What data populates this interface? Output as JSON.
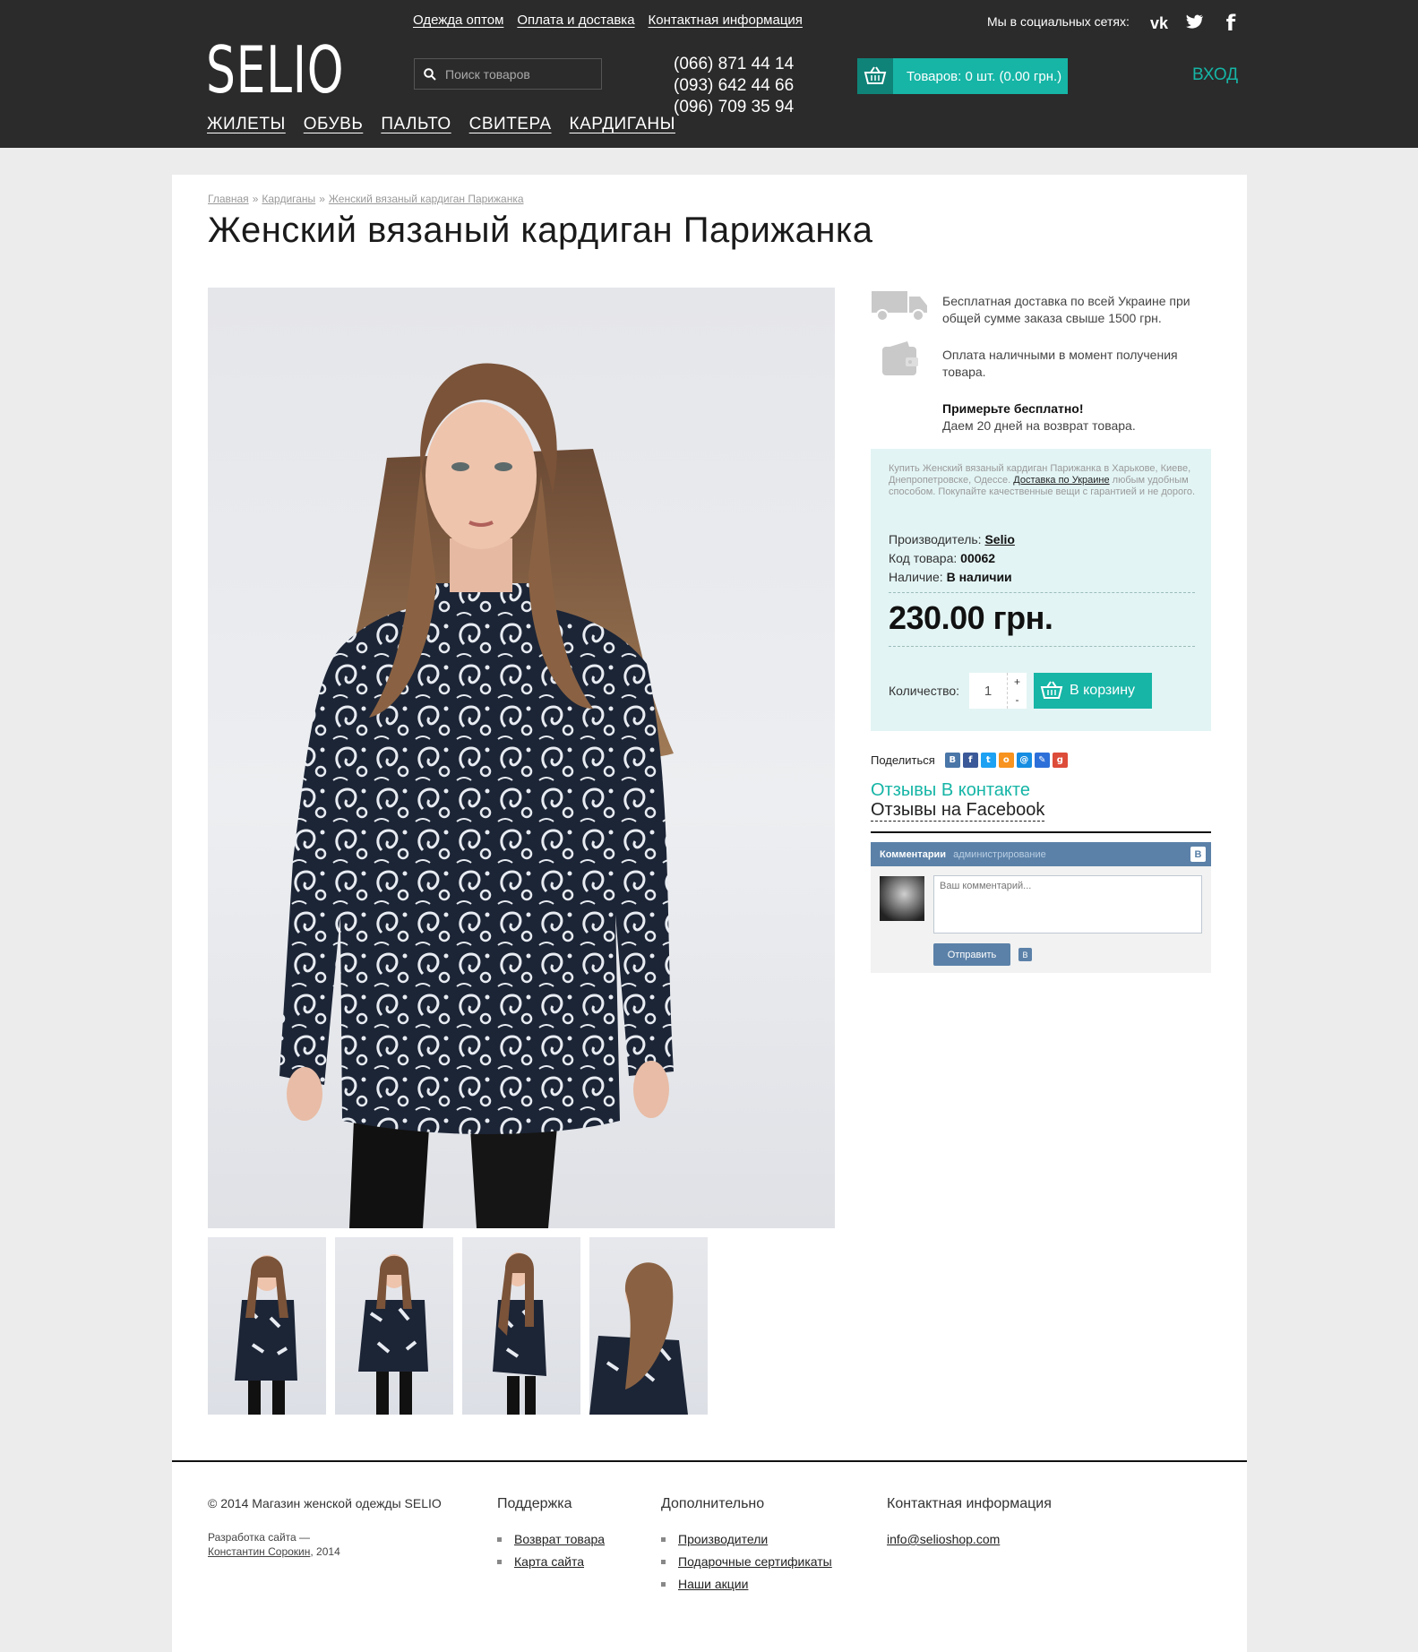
{
  "header": {
    "logo": "SELIO",
    "top_links": [
      "Одежда оптом",
      "Оплата и доставка",
      "Контактная информация"
    ],
    "search_placeholder": "Поиск товаров",
    "phones": [
      "(066) 871 44 14",
      "(093) 642 44 66",
      "(096) 709 35 94"
    ],
    "cart_label": "Товаров: 0 шт. (0.00 грн.)",
    "login": "ВХОД",
    "social_label": "Мы в социальных сетях:",
    "social_icons": [
      "vk-icon",
      "twitter-icon",
      "facebook-icon"
    ],
    "menu": [
      "ЖИЛЕТЫ",
      "ОБУВЬ",
      "ПАЛЬТО",
      "СВИТЕРА",
      "КАРДИГАНЫ"
    ]
  },
  "breadcrumb": [
    "Главная",
    "Кардиганы",
    "Женский вязаный кардиган Парижанка"
  ],
  "product": {
    "title": "Женский вязаный кардиган Парижанка",
    "benefits": [
      {
        "icon": "truck-icon",
        "text": "Бесплатная доставка по всей Украине при общей сумме заказа свыше 1500 грн."
      },
      {
        "icon": "wallet-icon",
        "text": "Оплата наличными в момент получения товара."
      }
    ],
    "try_title": "Примерьте бесплатно!",
    "try_text": "Даем 20 дней на возврат товара.",
    "desc_text": "Купить Женский вязаный кардиган Парижанка в Харькове, Киеве, Днепропетровске, Одессе.",
    "desc_link": "Доставка по Украине",
    "desc_text2": "любым удобным способом. Покупайте качественные вещи с гарантией и не дорого.",
    "manufacturer_label": "Производитель:",
    "manufacturer": "Selio",
    "sku_label": "Код товара:",
    "sku": "00062",
    "stock_label": "Наличие:",
    "stock": "В наличии",
    "price": "230.00 грн.",
    "qty_label": "Количество:",
    "qty": "1",
    "add_to_cart": "В корзину",
    "thumbnail_count": 4
  },
  "share_label": "Поделиться",
  "reviews_vk": "Отзывы В контакте",
  "reviews_fb": "Отзывы на Facebook",
  "vk_widget": {
    "title": "Комментарии",
    "admin": "администрирование",
    "placeholder": "Ваш комментарий...",
    "send": "Отправить"
  },
  "footer": {
    "copyright": "© 2014 Магазин женской одежды SELIO",
    "dev_label": "Разработка сайта —",
    "dev_name": "Константин Сорокин",
    "dev_year": ", 2014",
    "support_title": "Поддержка",
    "support_links": [
      "Возврат товара",
      "Карта сайта"
    ],
    "extra_title": "Дополнительно",
    "extra_links": [
      "Производители",
      "Подарочные сертификаты",
      "Наши акции"
    ],
    "contact_title": "Контактная информация",
    "email": "info@selioshop.com"
  },
  "colors": {
    "header_bg": "#2b2b2b",
    "accent": "#16b5a6",
    "buy_box_bg": "#e3f4f4",
    "vk_blue": "#5b81a8"
  }
}
